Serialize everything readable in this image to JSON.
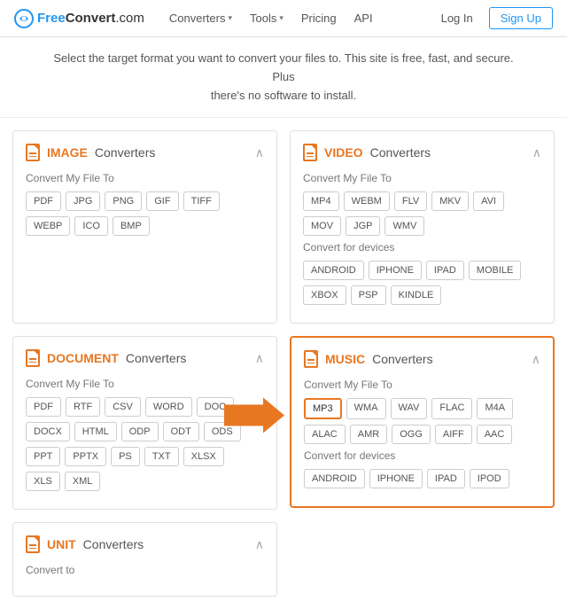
{
  "logo": {
    "free": "Free",
    "convert": "Convert",
    "dot_com": ".com"
  },
  "nav": {
    "converters": "Converters",
    "tools": "Tools",
    "pricing": "Pricing",
    "api": "API"
  },
  "header_right": {
    "login": "Log In",
    "signup": "Sign Up"
  },
  "subtitle": {
    "line1": "Select the target format you want to convert your files to. This site is free, fast, and secure. Plus",
    "line2": "there's no software to install."
  },
  "image_box": {
    "keyword": "IMAGE",
    "rest": " Converters",
    "section_label": "Convert My File To",
    "formats": [
      "PDF",
      "JPG",
      "PNG",
      "GIF",
      "TIFF",
      "WEBP",
      "ICO",
      "BMP"
    ]
  },
  "video_box": {
    "keyword": "VIDEO",
    "rest": " Converters",
    "section_label": "Convert My File To",
    "formats": [
      "MP4",
      "WEBM",
      "FLV",
      "MKV",
      "AVI",
      "MOV",
      "JGP",
      "WMV"
    ],
    "devices_label": "Convert for devices",
    "devices": [
      "ANDROID",
      "IPHONE",
      "IPAD",
      "MOBILE",
      "XBOX",
      "PSP",
      "KINDLE"
    ]
  },
  "document_box": {
    "keyword": "DOCUMENT",
    "rest": " Converters",
    "section_label": "Convert My File To",
    "formats": [
      "PDF",
      "RTF",
      "CSV",
      "WORD",
      "DOC",
      "DOCX",
      "HTML",
      "ODP",
      "ODT",
      "ODS",
      "PPT",
      "PPTX",
      "PS",
      "TXT",
      "XLSX",
      "XLS",
      "XML"
    ]
  },
  "music_box": {
    "keyword": "MUSIC",
    "rest": " Converters",
    "section_label": "Convert My File To",
    "formats_row1": [
      "MP3",
      "WMA",
      "WAV",
      "FLAC",
      "M4A"
    ],
    "formats_row2": [
      "ALAC",
      "AMR",
      "OGG",
      "AIFF",
      "AAC"
    ],
    "devices_label": "Convert for devices",
    "devices": [
      "ANDROID",
      "IPHONE",
      "IPAD",
      "IPOD"
    ],
    "highlighted_format": "MP3"
  },
  "unit_box": {
    "keyword": "UNIT",
    "rest": " Converters",
    "section_label": "Convert to"
  }
}
